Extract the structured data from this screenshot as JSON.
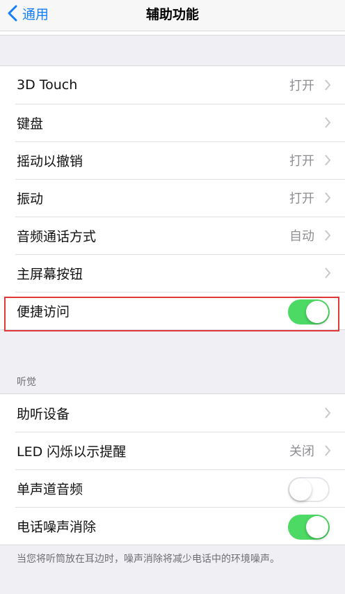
{
  "nav": {
    "back_label": "通用",
    "title": "辅助功能"
  },
  "group1": [
    {
      "label": "3D Touch",
      "value": "打开"
    },
    {
      "label": "键盘",
      "value": ""
    },
    {
      "label": "摇动以撤销",
      "value": "打开"
    },
    {
      "label": "振动",
      "value": "打开"
    },
    {
      "label": "音频通话方式",
      "value": "自动"
    },
    {
      "label": "主屏幕按钮",
      "value": ""
    },
    {
      "label": "便捷访问",
      "toggle": "on"
    }
  ],
  "hearing": {
    "header": "听觉",
    "rows": [
      {
        "label": "助听设备",
        "value": ""
      },
      {
        "label": "LED 闪烁以示提醒",
        "value": "关闭"
      },
      {
        "label": "单声道音频",
        "toggle": "off"
      },
      {
        "label": "电话噪声消除",
        "toggle": "on"
      }
    ],
    "footer": "当您将听筒放在耳边时，噪声消除将减少电话中的环境噪声。"
  },
  "colors": {
    "accent": "#147efb",
    "toggle_on": "#4cd964",
    "highlight": "#e0383a"
  }
}
